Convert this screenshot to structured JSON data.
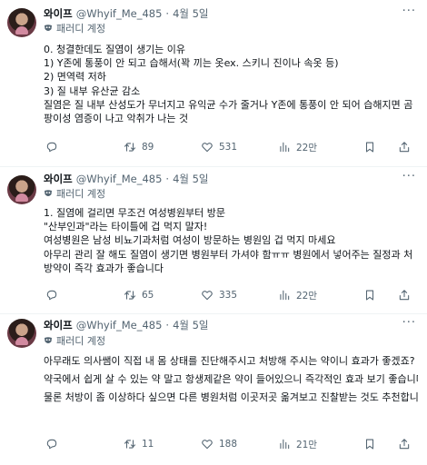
{
  "tweets": [
    {
      "name": "와이프",
      "handle": "@Whyif_Me_485",
      "date": "4월 5일",
      "parody_label": "패러디 계정",
      "lines": [
        "0. 청결한데도 질염이 생기는 이유",
        "1) Y존에 통풍이 안 되고 습해서(꽉 끼는 옷ex. 스키니 진이나 속옷 등)",
        "2) 면역력 저하",
        "3) 질 내부 유산균 감소",
        "질염은 질 내부 산성도가 무너지고 유익균 수가 줄거나 Y존에 통풍이 안 되어 습해지면 곰",
        "팡이성 염증이 나고 악취가 나는 것"
      ],
      "replies": "",
      "retweets": "89",
      "likes": "531",
      "views": "22만"
    },
    {
      "name": "와이프",
      "handle": "@Whyif_Me_485",
      "date": "4월 5일",
      "parody_label": "패러디 계정",
      "lines": [
        "1. 질염에 걸리면 무조건 여성병원부터 방문",
        "\"산부인과\"라는 타이틀에 겁 먹지 말자!",
        "여성병원은 남성 비뇨기과처럼 여성이 방문하는 병원임 겁 먹지 마세요",
        "아무리 관리 잘 해도 질염이 생기면 병원부터 가셔야 함ㅠㅠ 병원에서 넣어주는 질정과 처",
        "방약이 즉각 효과가 좋습니다"
      ],
      "replies": "",
      "retweets": "65",
      "likes": "335",
      "views": "22만"
    },
    {
      "name": "와이프",
      "handle": "@Whyif_Me_485",
      "date": "4월 5일",
      "parody_label": "패러디 계정",
      "lines": [
        "아무래도 의사쌤이 직접 내 몸 상태를 진단해주시고 처방해 주시는 약이니 효과가 좋겠죠?",
        "약국에서 쉽게 살 수 있는 약 말고 항생제같은 약이 들어있으니 즉각적인 효과 보기 좋습니다",
        "물론 처방이 좀 이상하다 싶으면 다른 병원처럼 이곳저곳 옮겨보고 진찰받는 것도 추천합니다"
      ],
      "replies": "",
      "retweets": "11",
      "likes": "188",
      "views": "21만"
    }
  ],
  "icons": {
    "more": "more-dots-icon",
    "reply": "reply-icon",
    "retweet": "retweet-icon",
    "like": "heart-icon",
    "views": "views-icon",
    "bookmark": "bookmark-icon",
    "share": "share-icon",
    "parody": "parody-mask-icon"
  },
  "colors": {
    "text": "#0f1419",
    "secondary": "#536471",
    "divider": "#eff3f4"
  }
}
